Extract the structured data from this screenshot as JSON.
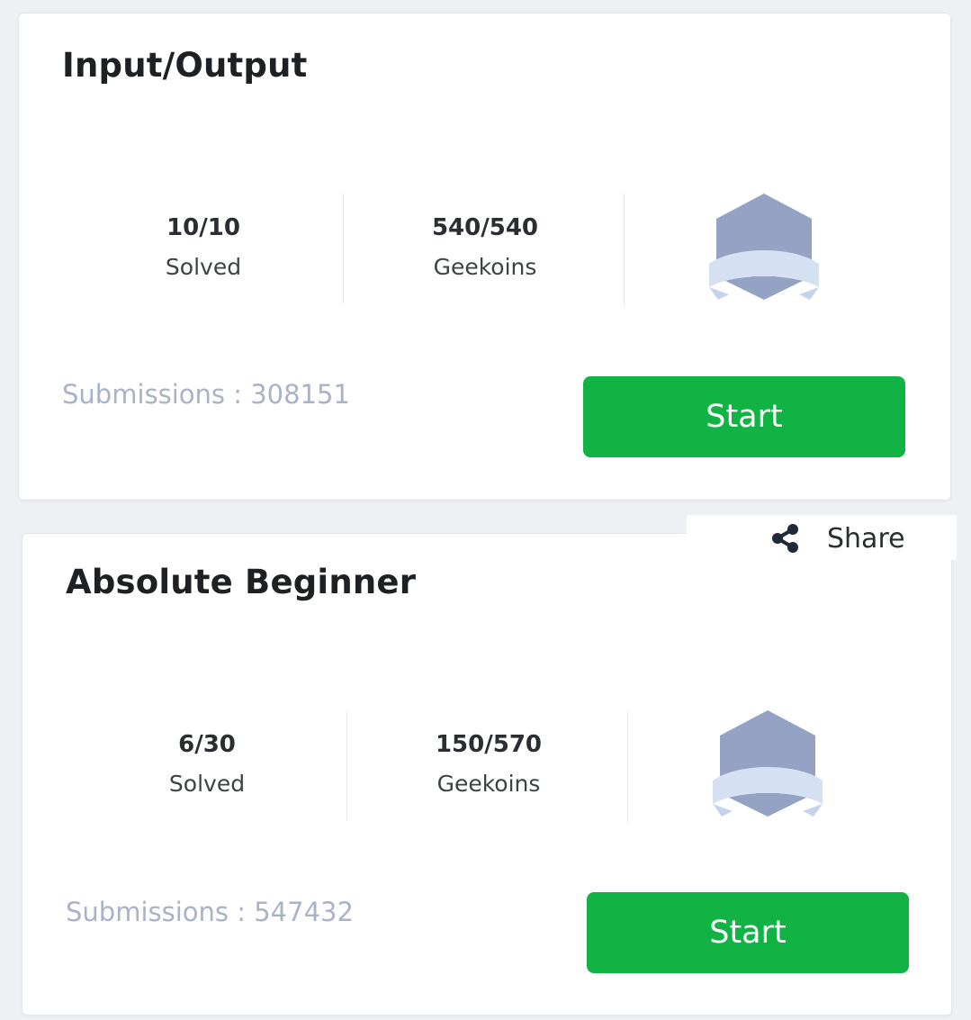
{
  "cards": [
    {
      "title": "Input/Output",
      "solved_value": "10/10",
      "solved_label": "Solved",
      "geekoins_value": "540/540",
      "geekoins_label": "Geekoins",
      "badge_icon": "badge-shield-icon",
      "submissions": "Submissions : 308151",
      "start_label": "Start"
    },
    {
      "title": "Absolute Beginner",
      "solved_value": "6/30",
      "solved_label": "Solved",
      "geekoins_value": "150/570",
      "geekoins_label": "Geekoins",
      "badge_icon": "badge-shield-icon",
      "submissions": "Submissions : 547432",
      "start_label": "Start"
    }
  ],
  "share": {
    "icon": "share-icon",
    "label": "Share"
  },
  "colors": {
    "start_button": "#12b345",
    "badge_primary": "#94a3c4",
    "badge_ribbon": "#d5e0f3",
    "submissions_text": "#a9b3c7"
  }
}
